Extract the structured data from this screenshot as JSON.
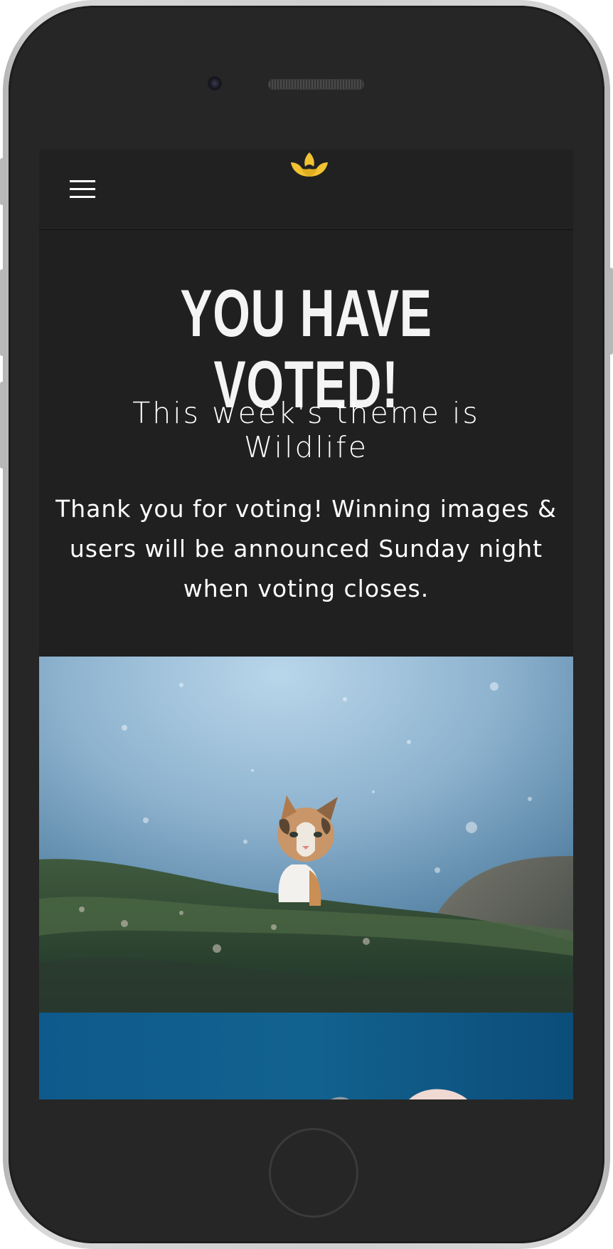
{
  "device": {
    "frame_color": "#262626",
    "bezel_color": "#cfcfcf"
  },
  "header": {
    "menu_icon": "hamburger-menu-icon",
    "logo_icon": "lotus-logo-icon",
    "logo_color": "#f2c232"
  },
  "main": {
    "headline": "YOU HAVE VOTED!",
    "theme_line": "This week's theme is Wildlife",
    "thanks_message": "Thank you for voting! Winning images & users will be announced Sunday night when voting closes."
  },
  "images": [
    {
      "name": "wildlife-cat-photo"
    },
    {
      "name": "wildlife-blue-photo"
    }
  ],
  "colors": {
    "screen_background": "#202020",
    "text": "#ffffff",
    "accent": "#f2c232"
  }
}
